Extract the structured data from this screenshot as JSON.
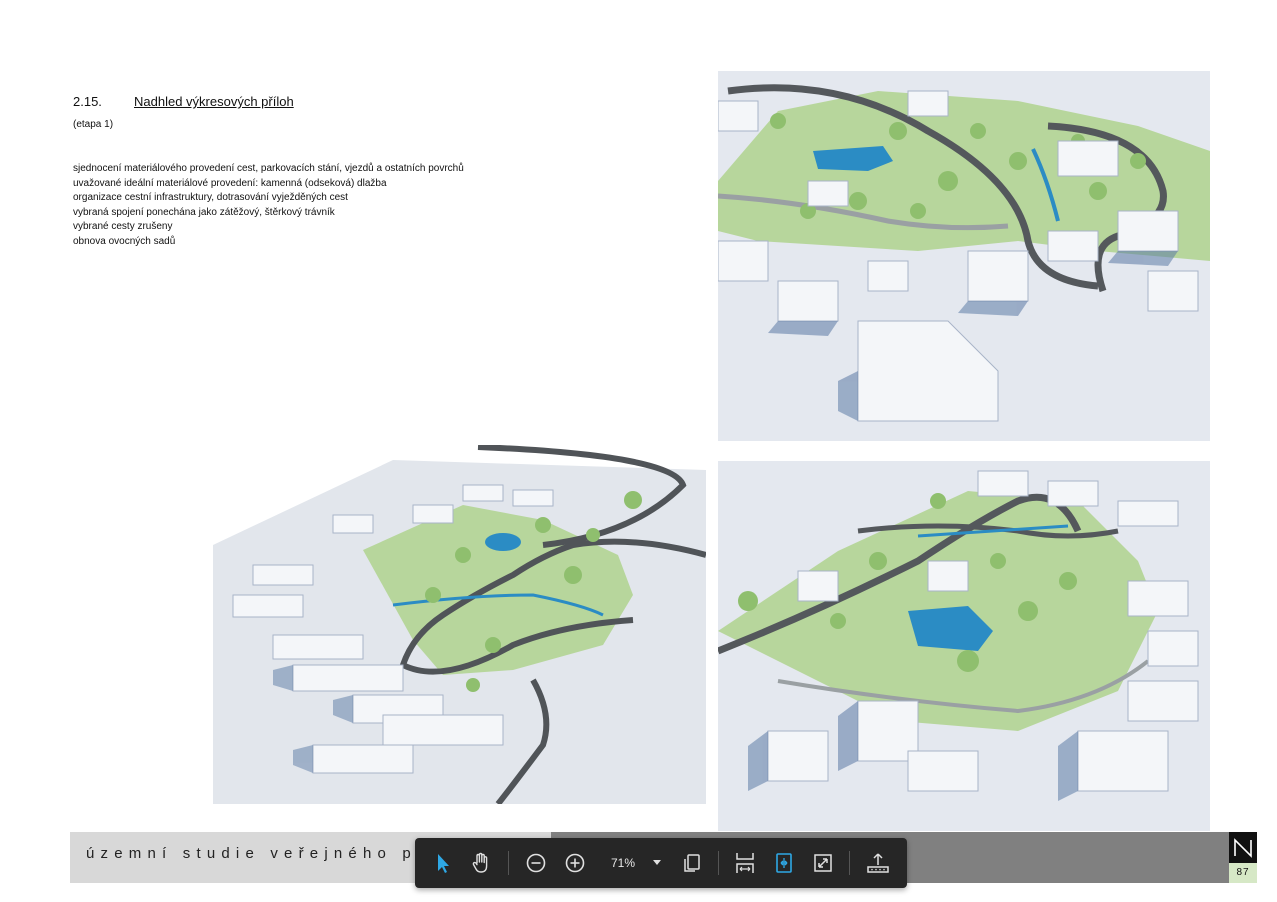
{
  "heading": {
    "number": "2.15.",
    "title": "Nadhled výkresových příloh"
  },
  "stage": "(etapa 1)",
  "bullets": [
    "sjednocení materiálového provedení cest, parkovacích stání, vjezdů a ostatních povrchů",
    "uvažované ideální materiálové provedení: kamenná (odseková) dlažba",
    "organizace cestní infrastruktury, dotrasování vyježděných cest",
    "vybraná spojení ponechána jako zátěžový, štěrkový trávník",
    "vybrané cesty zrušeny",
    "obnova ovocných sadů"
  ],
  "footer": {
    "text": "územní studie veřejného pr",
    "page_number": "87"
  },
  "toolbar": {
    "zoom_label": "71%",
    "tools": [
      "select-tool",
      "hand-tool",
      "zoom-out",
      "zoom-in",
      "zoom-dropdown",
      "page-thumbnails",
      "fit-width",
      "fit-page",
      "fullscreen",
      "download"
    ]
  },
  "colors": {
    "accent": "#2ea8e5",
    "toolbar_bg": "#262626",
    "footer_light": "#d8d8d8",
    "footer_dark": "#808080",
    "page_number_bg": "#d6e8c6",
    "grass": "#b5d69a",
    "water": "#2b8cc4",
    "road": "#505458",
    "building": "#f2f4f7"
  }
}
